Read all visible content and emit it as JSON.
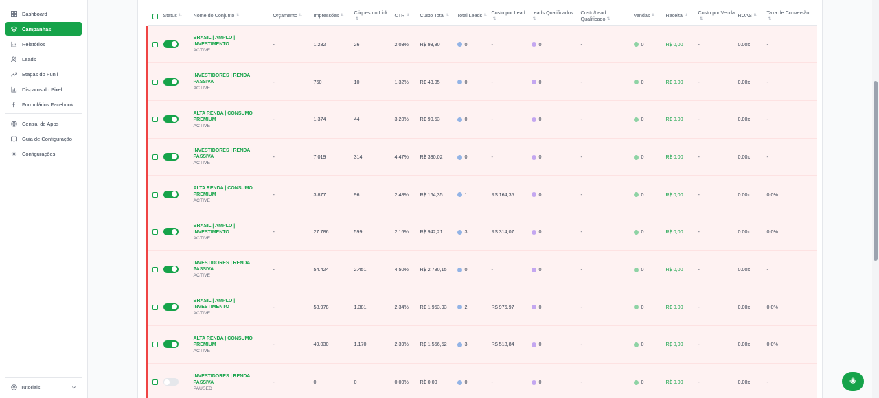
{
  "sidebar": {
    "items": [
      {
        "label": "Dashboard",
        "icon": "grid-icon"
      },
      {
        "label": "Campanhas",
        "icon": "layers-icon",
        "active": true
      },
      {
        "label": "Relatórios",
        "icon": "chart-icon"
      },
      {
        "label": "Leads",
        "icon": "users-icon"
      },
      {
        "label": "Etapas do Funil",
        "icon": "trend-icon"
      },
      {
        "label": "Disparos do Pixel",
        "icon": "bar-icon"
      },
      {
        "label": "Formulários Facebook",
        "icon": "facebook-icon"
      },
      {
        "label": "Central de Apps",
        "icon": "apps-icon"
      },
      {
        "label": "Guia de Configuração",
        "icon": "book-icon"
      },
      {
        "label": "Configurações",
        "icon": "gear-icon"
      }
    ],
    "bottom": {
      "label": "Tutoriais",
      "icon": "help-icon"
    }
  },
  "table": {
    "headers": {
      "status": "Status",
      "name": "Nome do Conjunto",
      "budget": "Orçamento",
      "impressions": "Impressões",
      "clicks": "Cliques no Link",
      "ctr": "CTR",
      "cost": "Custo Total",
      "leads": "Total Leads",
      "cpl": "Custo por Lead",
      "qleads": "Leads Qualificados",
      "cpql": "Custo/Lead Qualificado",
      "sales": "Vendas",
      "revenue": "Receita",
      "cps": "Custo por Venda",
      "roas": "ROAS",
      "conv": "Taxa de Conversão"
    },
    "rows": [
      {
        "on": true,
        "name": "BRASIL | AMPLO | INVESTIMENTO",
        "status": "ACTIVE",
        "budget": "-",
        "impressions": "1.282",
        "clicks": "26",
        "ctr": "2.03%",
        "cost": "R$ 93,80",
        "leads": "0",
        "cpl": "-",
        "qleads": "0",
        "cpql": "-",
        "sales": "0",
        "revenue": "R$ 0,00",
        "cps": "-",
        "roas": "0.00x",
        "conv": "-"
      },
      {
        "on": true,
        "name": "INVESTIDORES | RENDA PASSIVA",
        "status": "ACTIVE",
        "budget": "-",
        "impressions": "760",
        "clicks": "10",
        "ctr": "1.32%",
        "cost": "R$ 43,05",
        "leads": "0",
        "cpl": "-",
        "qleads": "0",
        "cpql": "-",
        "sales": "0",
        "revenue": "R$ 0,00",
        "cps": "-",
        "roas": "0.00x",
        "conv": "-"
      },
      {
        "on": true,
        "name": "ALTA RENDA | CONSUMO PREMIUM",
        "status": "ACTIVE",
        "budget": "-",
        "impressions": "1.374",
        "clicks": "44",
        "ctr": "3.20%",
        "cost": "R$ 90,53",
        "leads": "0",
        "cpl": "-",
        "qleads": "0",
        "cpql": "-",
        "sales": "0",
        "revenue": "R$ 0,00",
        "cps": "-",
        "roas": "0.00x",
        "conv": "-"
      },
      {
        "on": true,
        "name": "INVESTIDORES | RENDA PASSIVA",
        "status": "ACTIVE",
        "budget": "-",
        "impressions": "7.019",
        "clicks": "314",
        "ctr": "4.47%",
        "cost": "R$ 330,02",
        "leads": "0",
        "cpl": "-",
        "qleads": "0",
        "cpql": "-",
        "sales": "0",
        "revenue": "R$ 0,00",
        "cps": "-",
        "roas": "0.00x",
        "conv": "-"
      },
      {
        "on": true,
        "name": "ALTA RENDA | CONSUMO PREMIUM",
        "status": "ACTIVE",
        "budget": "-",
        "impressions": "3.877",
        "clicks": "96",
        "ctr": "2.48%",
        "cost": "R$ 164,35",
        "leads": "1",
        "cpl": "R$ 164,35",
        "qleads": "0",
        "cpql": "-",
        "sales": "0",
        "revenue": "R$ 0,00",
        "cps": "-",
        "roas": "0.00x",
        "conv": "0.0%"
      },
      {
        "on": true,
        "name": "BRASIL | AMPLO | INVESTIMENTO",
        "status": "ACTIVE",
        "budget": "-",
        "impressions": "27.786",
        "clicks": "599",
        "ctr": "2.16%",
        "cost": "R$ 942,21",
        "leads": "3",
        "cpl": "R$ 314,07",
        "qleads": "0",
        "cpql": "-",
        "sales": "0",
        "revenue": "R$ 0,00",
        "cps": "-",
        "roas": "0.00x",
        "conv": "0.0%"
      },
      {
        "on": true,
        "name": "INVESTIDORES | RENDA PASSIVA",
        "status": "ACTIVE",
        "budget": "-",
        "impressions": "54.424",
        "clicks": "2.451",
        "ctr": "4.50%",
        "cost": "R$ 2.780,15",
        "leads": "0",
        "cpl": "-",
        "qleads": "0",
        "cpql": "-",
        "sales": "0",
        "revenue": "R$ 0,00",
        "cps": "-",
        "roas": "0.00x",
        "conv": "-"
      },
      {
        "on": true,
        "name": "BRASIL | AMPLO | INVESTIMENTO",
        "status": "ACTIVE",
        "budget": "-",
        "impressions": "58.978",
        "clicks": "1.381",
        "ctr": "2.34%",
        "cost": "R$ 1.953,93",
        "leads": "2",
        "cpl": "R$ 976,97",
        "qleads": "0",
        "cpql": "-",
        "sales": "0",
        "revenue": "R$ 0,00",
        "cps": "-",
        "roas": "0.00x",
        "conv": "0.0%"
      },
      {
        "on": true,
        "name": "ALTA RENDA | CONSUMO PREMIUM",
        "status": "ACTIVE",
        "budget": "-",
        "impressions": "49.030",
        "clicks": "1.170",
        "ctr": "2.39%",
        "cost": "R$ 1.556,52",
        "leads": "3",
        "cpl": "R$ 518,84",
        "qleads": "0",
        "cpql": "-",
        "sales": "0",
        "revenue": "R$ 0,00",
        "cps": "-",
        "roas": "0.00x",
        "conv": "0.0%"
      },
      {
        "on": false,
        "name": "INVESTIDORES | RENDA PASSIVA",
        "status": "PAUSED",
        "budget": "-",
        "impressions": "0",
        "clicks": "0",
        "ctr": "0.00%",
        "cost": "R$ 0,00",
        "leads": "0",
        "cpl": "-",
        "qleads": "0",
        "cpql": "-",
        "sales": "0",
        "revenue": "R$ 0,00",
        "cps": "-",
        "roas": "0.00x",
        "conv": "-"
      }
    ]
  },
  "colors": {
    "accent": "#16a34a",
    "row_highlight": "#fef2f2",
    "row_border": "#ef4444"
  }
}
